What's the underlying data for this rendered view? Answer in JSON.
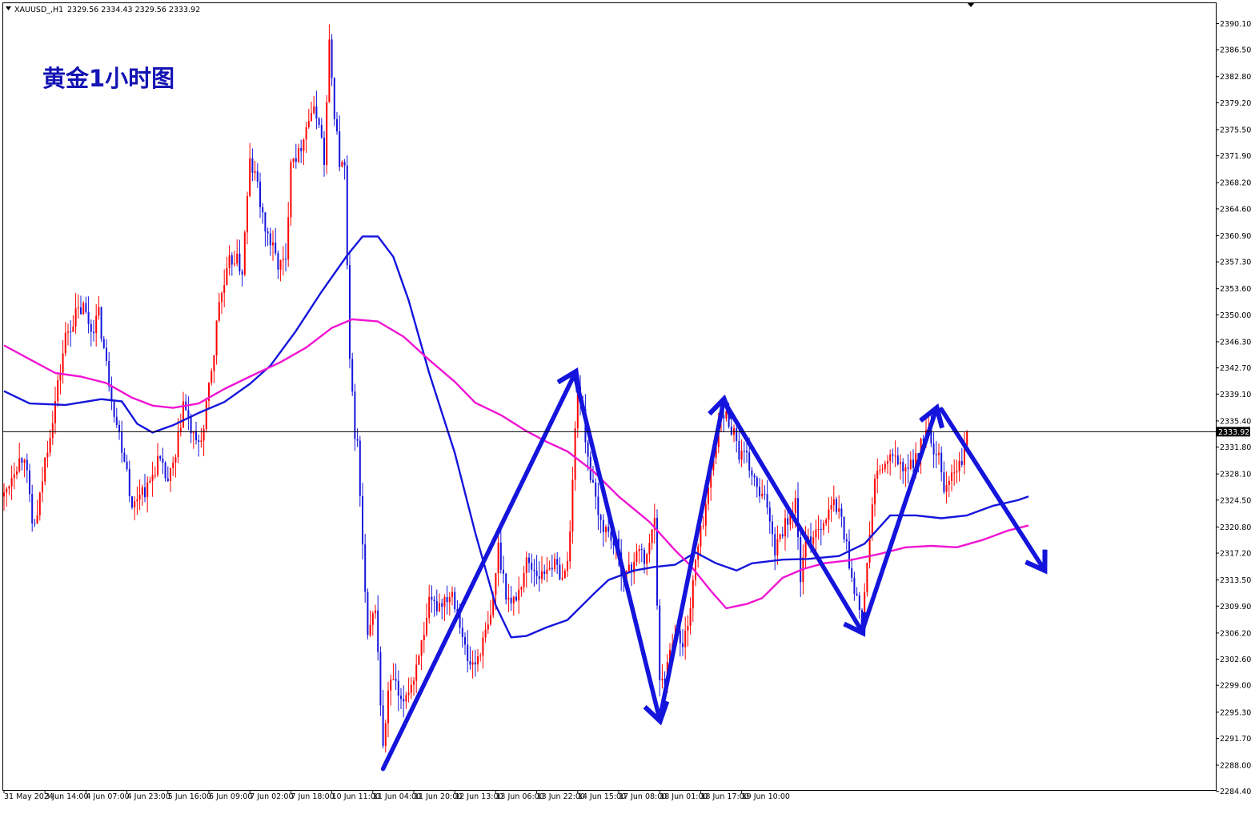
{
  "chart_data": {
    "type": "candlestick",
    "header": {
      "symbol": "XAUUSD_,H1",
      "ohlc_text": "2329.56 2334.43 2329.56 2333.92"
    },
    "title_annotation": "黄金1小时图",
    "current_price": {
      "label": "2333.92",
      "value": 2333.92
    },
    "y_ticks": [
      {
        "label": "2390.10",
        "value": 2390.1
      },
      {
        "label": "2386.50",
        "value": 2386.5
      },
      {
        "label": "2382.80",
        "value": 2382.8
      },
      {
        "label": "2379.20",
        "value": 2379.2
      },
      {
        "label": "2375.50",
        "value": 2375.5
      },
      {
        "label": "2371.90",
        "value": 2371.9
      },
      {
        "label": "2368.20",
        "value": 2368.2
      },
      {
        "label": "2364.60",
        "value": 2364.6
      },
      {
        "label": "2360.90",
        "value": 2360.9
      },
      {
        "label": "2357.30",
        "value": 2357.3
      },
      {
        "label": "2353.60",
        "value": 2353.6
      },
      {
        "label": "2350.00",
        "value": 2350.0
      },
      {
        "label": "2346.30",
        "value": 2346.3
      },
      {
        "label": "2342.70",
        "value": 2342.7
      },
      {
        "label": "2339.10",
        "value": 2339.1
      },
      {
        "label": "2335.40",
        "value": 2335.4
      },
      {
        "label": "2331.80",
        "value": 2331.8
      },
      {
        "label": "2328.10",
        "value": 2328.1
      },
      {
        "label": "2324.50",
        "value": 2324.5
      },
      {
        "label": "2320.80",
        "value": 2320.8
      },
      {
        "label": "2317.20",
        "value": 2317.2
      },
      {
        "label": "2313.50",
        "value": 2313.5
      },
      {
        "label": "2309.90",
        "value": 2309.9
      },
      {
        "label": "2306.20",
        "value": 2306.2
      },
      {
        "label": "2302.60",
        "value": 2302.6
      },
      {
        "label": "2299.00",
        "value": 2299.0
      },
      {
        "label": "2295.30",
        "value": 2295.3
      },
      {
        "label": "2291.70",
        "value": 2291.7
      },
      {
        "label": "2288.00",
        "value": 2288.0
      },
      {
        "label": "2284.40",
        "value": 2284.4
      }
    ],
    "y_range": [
      2284.4,
      2391.8
    ],
    "x_tick_labels": [
      "31 May 2024",
      "3 Jun 14:00",
      "4 Jun 07:00",
      "4 Jun 23:00",
      "5 Jun 16:00",
      "6 Jun 09:00",
      "7 Jun 02:00",
      "7 Jun 18:00",
      "10 Jun 11:00",
      "11 Jun 04:00",
      "11 Jun 20:00",
      "12 Jun 13:00",
      "13 Jun 06:00",
      "13 Jun 22:00",
      "14 Jun 15:00",
      "17 Jun 08:00",
      "18 Jun 01:00",
      "18 Jun 17:00",
      "19 Jun 10:00"
    ],
    "bars_per_tick": 16,
    "series": [
      {
        "name": "",
        "color": "#1414dc",
        "points": [
          [
            0,
            2339.5
          ],
          [
            10,
            2337.8
          ],
          [
            24,
            2337.6
          ],
          [
            38,
            2338.4
          ],
          [
            46,
            2338.1
          ],
          [
            52,
            2335.0
          ],
          [
            58,
            2333.8
          ],
          [
            66,
            2334.8
          ],
          [
            76,
            2336.5
          ],
          [
            86,
            2338.0
          ],
          [
            96,
            2340.5
          ],
          [
            104,
            2343.0
          ],
          [
            114,
            2347.8
          ],
          [
            124,
            2353.2
          ],
          [
            134,
            2358.2
          ],
          [
            140,
            2360.8
          ],
          [
            146,
            2360.8
          ],
          [
            152,
            2358.0
          ],
          [
            158,
            2352.0
          ],
          [
            166,
            2342.0
          ],
          [
            176,
            2331.0
          ],
          [
            184,
            2320.0
          ],
          [
            192,
            2310.0
          ],
          [
            198,
            2305.6
          ],
          [
            204,
            2305.8
          ],
          [
            212,
            2307.0
          ],
          [
            220,
            2308.0
          ],
          [
            230,
            2311.5
          ],
          [
            236,
            2313.5
          ],
          [
            246,
            2314.8
          ],
          [
            254,
            2315.3
          ],
          [
            262,
            2315.6
          ],
          [
            270,
            2317.3
          ],
          [
            278,
            2315.8
          ],
          [
            286,
            2314.8
          ],
          [
            292,
            2315.8
          ],
          [
            304,
            2316.3
          ],
          [
            314,
            2316.4
          ],
          [
            326,
            2316.8
          ],
          [
            336,
            2318.5
          ],
          [
            346,
            2322.4
          ],
          [
            356,
            2322.4
          ],
          [
            366,
            2322.0
          ],
          [
            376,
            2322.4
          ],
          [
            386,
            2323.7
          ],
          [
            396,
            2324.5
          ],
          [
            400,
            2325.0
          ]
        ]
      },
      {
        "name": "",
        "color": "#f014d2",
        "points": [
          [
            0,
            2345.8
          ],
          [
            10,
            2343.9
          ],
          [
            20,
            2342.0
          ],
          [
            30,
            2341.5
          ],
          [
            40,
            2340.6
          ],
          [
            50,
            2338.6
          ],
          [
            58,
            2337.5
          ],
          [
            66,
            2337.2
          ],
          [
            76,
            2337.8
          ],
          [
            86,
            2339.8
          ],
          [
            96,
            2341.5
          ],
          [
            108,
            2343.5
          ],
          [
            118,
            2345.5
          ],
          [
            128,
            2348.2
          ],
          [
            136,
            2349.4
          ],
          [
            146,
            2349.1
          ],
          [
            156,
            2347.0
          ],
          [
            166,
            2343.8
          ],
          [
            176,
            2340.8
          ],
          [
            184,
            2337.9
          ],
          [
            194,
            2336.2
          ],
          [
            204,
            2334.0
          ],
          [
            212,
            2332.5
          ],
          [
            220,
            2331.2
          ],
          [
            230,
            2328.5
          ],
          [
            240,
            2325.0
          ],
          [
            252,
            2321.5
          ],
          [
            262,
            2317.6
          ],
          [
            268,
            2315.5
          ],
          [
            276,
            2312.0
          ],
          [
            282,
            2309.6
          ],
          [
            290,
            2310.2
          ],
          [
            296,
            2311.0
          ],
          [
            304,
            2313.8
          ],
          [
            312,
            2315.0
          ],
          [
            320,
            2315.8
          ],
          [
            330,
            2316.2
          ],
          [
            342,
            2317.1
          ],
          [
            352,
            2318.0
          ],
          [
            362,
            2318.2
          ],
          [
            372,
            2318.0
          ],
          [
            382,
            2319.0
          ],
          [
            392,
            2320.3
          ],
          [
            400,
            2321.0
          ]
        ]
      }
    ],
    "annotations": [
      {
        "type": "arrow",
        "from": [
          148,
          2287.5
        ],
        "to": [
          223,
          2342.0
        ]
      },
      {
        "type": "arrow",
        "from": [
          223,
          2341.5
        ],
        "to": [
          256,
          2294.3
        ]
      },
      {
        "type": "arrow",
        "from": [
          256,
          2294.3
        ],
        "to": [
          281,
          2338.2
        ]
      },
      {
        "type": "arrow",
        "from": [
          281,
          2338.2
        ],
        "to": [
          335,
          2306.4
        ]
      },
      {
        "type": "arrow",
        "from": [
          335,
          2306.4
        ],
        "to": [
          364,
          2337.0
        ]
      },
      {
        "type": "arrow",
        "from": [
          366,
          2337.0
        ],
        "to": [
          406,
          2315.0
        ]
      }
    ],
    "grid": false,
    "legend": "none",
    "price_points": [
      [
        0,
        2325
      ],
      [
        4,
        2329
      ],
      [
        8,
        2331
      ],
      [
        11,
        2321
      ],
      [
        13,
        2322
      ],
      [
        16,
        2330
      ],
      [
        20,
        2338
      ],
      [
        24,
        2347
      ],
      [
        28,
        2350
      ],
      [
        31,
        2351
      ],
      [
        34,
        2348
      ],
      [
        37,
        2350
      ],
      [
        40,
        2343
      ],
      [
        44,
        2335
      ],
      [
        48,
        2329
      ],
      [
        50,
        2323
      ],
      [
        53,
        2326
      ],
      [
        56,
        2326
      ],
      [
        60,
        2330
      ],
      [
        64,
        2327
      ],
      [
        67,
        2330
      ],
      [
        70,
        2338
      ],
      [
        73,
        2334
      ],
      [
        75,
        2332
      ],
      [
        78,
        2334
      ],
      [
        80,
        2340
      ],
      [
        82,
        2345
      ],
      [
        84,
        2352
      ],
      [
        86,
        2354
      ],
      [
        88,
        2357
      ],
      [
        90,
        2358
      ],
      [
        93,
        2356
      ],
      [
        96,
        2371
      ],
      [
        99,
        2368
      ],
      [
        101,
        2363
      ],
      [
        104,
        2360
      ],
      [
        107,
        2357
      ],
      [
        110,
        2357
      ],
      [
        112,
        2372
      ],
      [
        115,
        2372
      ],
      [
        117,
        2375
      ],
      [
        120,
        2378
      ],
      [
        123,
        2377
      ],
      [
        125,
        2371
      ],
      [
        127,
        2387
      ],
      [
        129,
        2378
      ],
      [
        131,
        2371
      ],
      [
        133,
        2370
      ],
      [
        135,
        2343
      ],
      [
        137,
        2334
      ],
      [
        138,
        2332
      ],
      [
        140,
        2318
      ],
      [
        142,
        2305
      ],
      [
        145,
        2310
      ],
      [
        148,
        2290
      ],
      [
        150,
        2298
      ],
      [
        152,
        2300
      ],
      [
        155,
        2296
      ],
      [
        157,
        2298
      ],
      [
        160,
        2300
      ],
      [
        162,
        2304
      ],
      [
        164,
        2305
      ],
      [
        166,
        2310
      ],
      [
        169,
        2310
      ],
      [
        172,
        2311
      ],
      [
        175,
        2312
      ],
      [
        178,
        2308
      ],
      [
        181,
        2302
      ],
      [
        184,
        2302
      ],
      [
        186,
        2304
      ],
      [
        190,
        2308
      ],
      [
        193,
        2318
      ],
      [
        196,
        2312
      ],
      [
        198,
        2310
      ],
      [
        201,
        2312
      ],
      [
        204,
        2316
      ],
      [
        207,
        2315
      ],
      [
        210,
        2314
      ],
      [
        213,
        2316
      ],
      [
        216,
        2315
      ],
      [
        219,
        2314
      ],
      [
        221,
        2320
      ],
      [
        223,
        2334
      ],
      [
        224,
        2341
      ],
      [
        226,
        2336
      ],
      [
        229,
        2328
      ],
      [
        232,
        2322
      ],
      [
        236,
        2320
      ],
      [
        239,
        2318
      ],
      [
        242,
        2314
      ],
      [
        245,
        2315
      ],
      [
        247,
        2318
      ],
      [
        250,
        2316
      ],
      [
        252,
        2318
      ],
      [
        254,
        2323
      ],
      [
        256,
        2299
      ],
      [
        258,
        2300
      ],
      [
        260,
        2304
      ],
      [
        262,
        2307
      ],
      [
        265,
        2304
      ],
      [
        268,
        2310
      ],
      [
        270,
        2316
      ],
      [
        273,
        2322
      ],
      [
        276,
        2328
      ],
      [
        278,
        2333
      ],
      [
        280,
        2336
      ],
      [
        282,
        2336
      ],
      [
        285,
        2334
      ],
      [
        287,
        2331
      ],
      [
        290,
        2330
      ],
      [
        292,
        2328
      ],
      [
        295,
        2325
      ],
      [
        298,
        2324
      ],
      [
        301,
        2318
      ],
      [
        303,
        2320
      ],
      [
        306,
        2322
      ],
      [
        309,
        2324
      ],
      [
        311,
        2314
      ],
      [
        313,
        2318
      ],
      [
        316,
        2320
      ],
      [
        318,
        2321
      ],
      [
        321,
        2322
      ],
      [
        324,
        2324
      ],
      [
        327,
        2322
      ],
      [
        329,
        2318
      ],
      [
        331,
        2314
      ],
      [
        333,
        2311
      ],
      [
        335,
        2308
      ],
      [
        338,
        2320
      ],
      [
        340,
        2327
      ],
      [
        343,
        2329
      ],
      [
        346,
        2330
      ],
      [
        349,
        2330
      ],
      [
        352,
        2328
      ],
      [
        355,
        2330
      ],
      [
        357,
        2331
      ],
      [
        359,
        2333
      ],
      [
        361,
        2334
      ],
      [
        363,
        2330
      ],
      [
        365,
        2330
      ],
      [
        367,
        2326
      ],
      [
        370,
        2328
      ],
      [
        373,
        2329
      ],
      [
        375,
        2331
      ],
      [
        376,
        2333.9
      ]
    ]
  }
}
